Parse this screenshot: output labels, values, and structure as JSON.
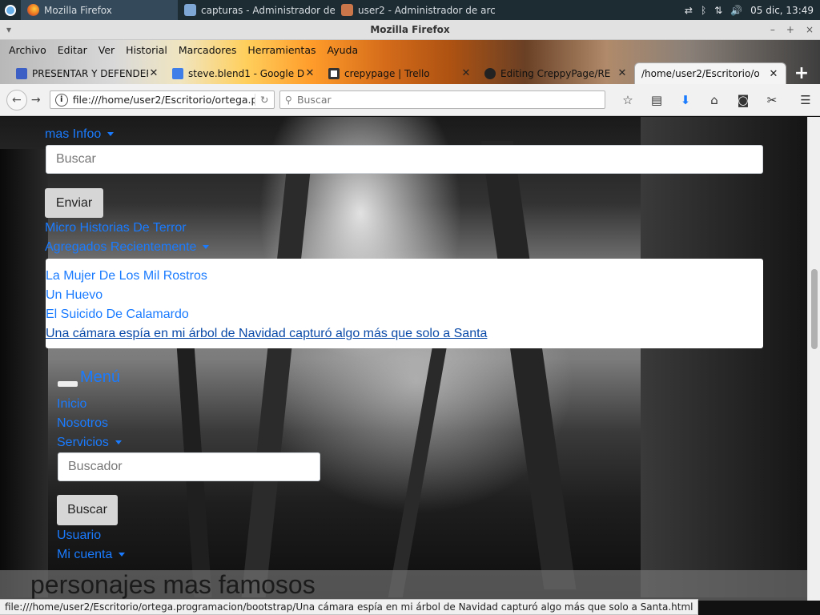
{
  "taskbar": {
    "apps": [
      {
        "label": "Mozilla Firefox",
        "icon": "firefox-icon",
        "color": "#e8671f"
      },
      {
        "label": "capturas - Administrador de ...",
        "icon": "folder-icon",
        "color": "#7fa7d6"
      },
      {
        "label": "user2 - Administrador de arc...",
        "icon": "home-folder-icon",
        "color": "#c8764a"
      }
    ],
    "clock": "05 dic, 13:49"
  },
  "window": {
    "title": "Mozilla Firefox",
    "controls": [
      "–",
      "+",
      "×"
    ]
  },
  "menubar": [
    "Archivo",
    "Editar",
    "Ver",
    "Historial",
    "Marcadores",
    "Herramientas",
    "Ayuda"
  ],
  "tabs": [
    {
      "label": "PRESENTAR Y DEFENDER",
      "icon": "classroom-icon",
      "color": "#3b5fc4",
      "active": false
    },
    {
      "label": "steve.blend1 - Google D",
      "icon": "docs-icon",
      "color": "#3f7ee8",
      "active": false
    },
    {
      "label": "crepypage | Trello",
      "icon": "trello-icon",
      "color": "#ffffff",
      "active": false
    },
    {
      "label": "Editing CreppyPage/RE",
      "icon": "github-icon",
      "color": "#222222",
      "active": false
    },
    {
      "label": "/home/user2/Escritorio/o",
      "icon": "none",
      "color": "#ffffff",
      "active": true
    }
  ],
  "navbar": {
    "url": "file:///home/user2/Escritorio/ortega.p",
    "search_placeholder": "Buscar"
  },
  "page": {
    "top_link": "mas Infoo",
    "search_placeholder": "Buscar",
    "send_label": "Enviar",
    "micro_link": "Micro Historias De Terror",
    "recent_link": "Agregados Recientemente",
    "recent_items": [
      "La Mujer De Los Mil Rostros",
      "Un Huevo",
      "El Suicido De Calamardo",
      "Una cámara espía en mi árbol de Navidad capturó algo más que solo a Santa"
    ],
    "menu_title": "Menú",
    "nav_links": [
      "Inicio",
      "Nosotros",
      "Servicios"
    ],
    "finder_placeholder": "Buscador",
    "finder_button": "Buscar",
    "user_link": "Usuario",
    "account_link": "Mi cuenta",
    "heading": "personajes mas famosos",
    "link_color": "#1a7bff"
  },
  "status_url": "file:///home/user2/Escritorio/ortega.programacion/bootstrap/Una cámara espía en mi árbol de Navidad capturó algo más que solo a Santa.html"
}
